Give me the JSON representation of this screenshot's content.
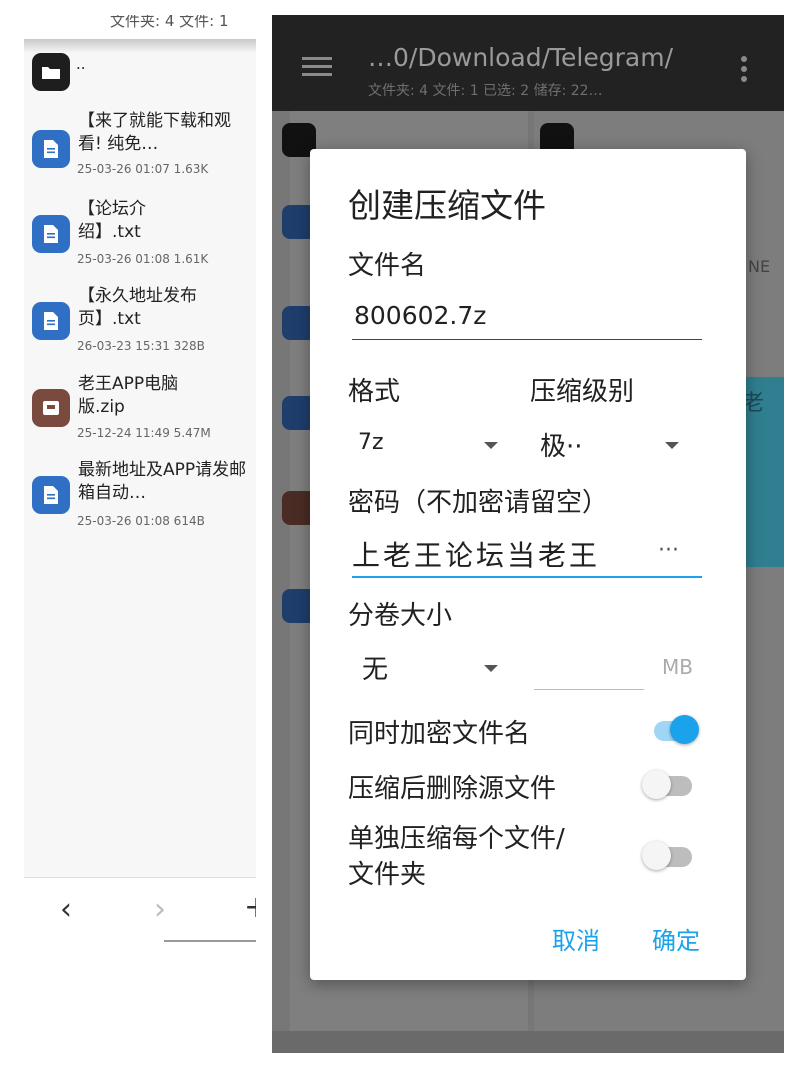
{
  "left": {
    "status_text": "文件夹: 4  文件: 1",
    "parent_dir": "..",
    "files": [
      {
        "name": "【来了就能下载和观看! 纯免…",
        "meta": "25-03-26 01:07  1.63K",
        "type": "doc"
      },
      {
        "name": "【论坛介绍】.txt",
        "meta": "25-03-26 01:08  1.61K",
        "type": "doc"
      },
      {
        "name": "【永久地址发布页】.txt",
        "meta": "26-03-23 15:31  328B",
        "type": "doc"
      },
      {
        "name": "老王APP电脑版.zip",
        "meta": "25-12-24 11:49  5.47M",
        "type": "zip"
      },
      {
        "name": "最新地址及APP请发邮箱自动…",
        "meta": "25-03-26 01:08  614B",
        "type": "doc"
      }
    ],
    "nav": {
      "back": "‹",
      "forward": "›",
      "add": "+"
    }
  },
  "right": {
    "path": "…0/Download/Telegram/",
    "stats": "文件夹: 4  文件: 1  已选: 2  储存: 22…",
    "parent_dir": "..",
    "peek_texts": [
      "NE",
      "老"
    ]
  },
  "dialog": {
    "title": "创建压缩文件",
    "filename_label": "文件名",
    "filename_value": "800602.7z",
    "format_label": "格式",
    "format_value": "7z",
    "level_label": "压缩级别",
    "level_value": "极··",
    "password_label": "密码（不加密请留空）",
    "password_value": "上老王论坛当老王",
    "password_more": "···",
    "volume_label": "分卷大小",
    "volume_value": "无",
    "volume_unit": "MB",
    "toggles": [
      {
        "label": "同时加密文件名",
        "on": true
      },
      {
        "label": "压缩后删除源文件",
        "on": false
      },
      {
        "label": "单独压缩每个文件/\n文件夹",
        "on": false
      }
    ],
    "cancel": "取消",
    "ok": "确定",
    "accent": "#1aa3ea"
  }
}
